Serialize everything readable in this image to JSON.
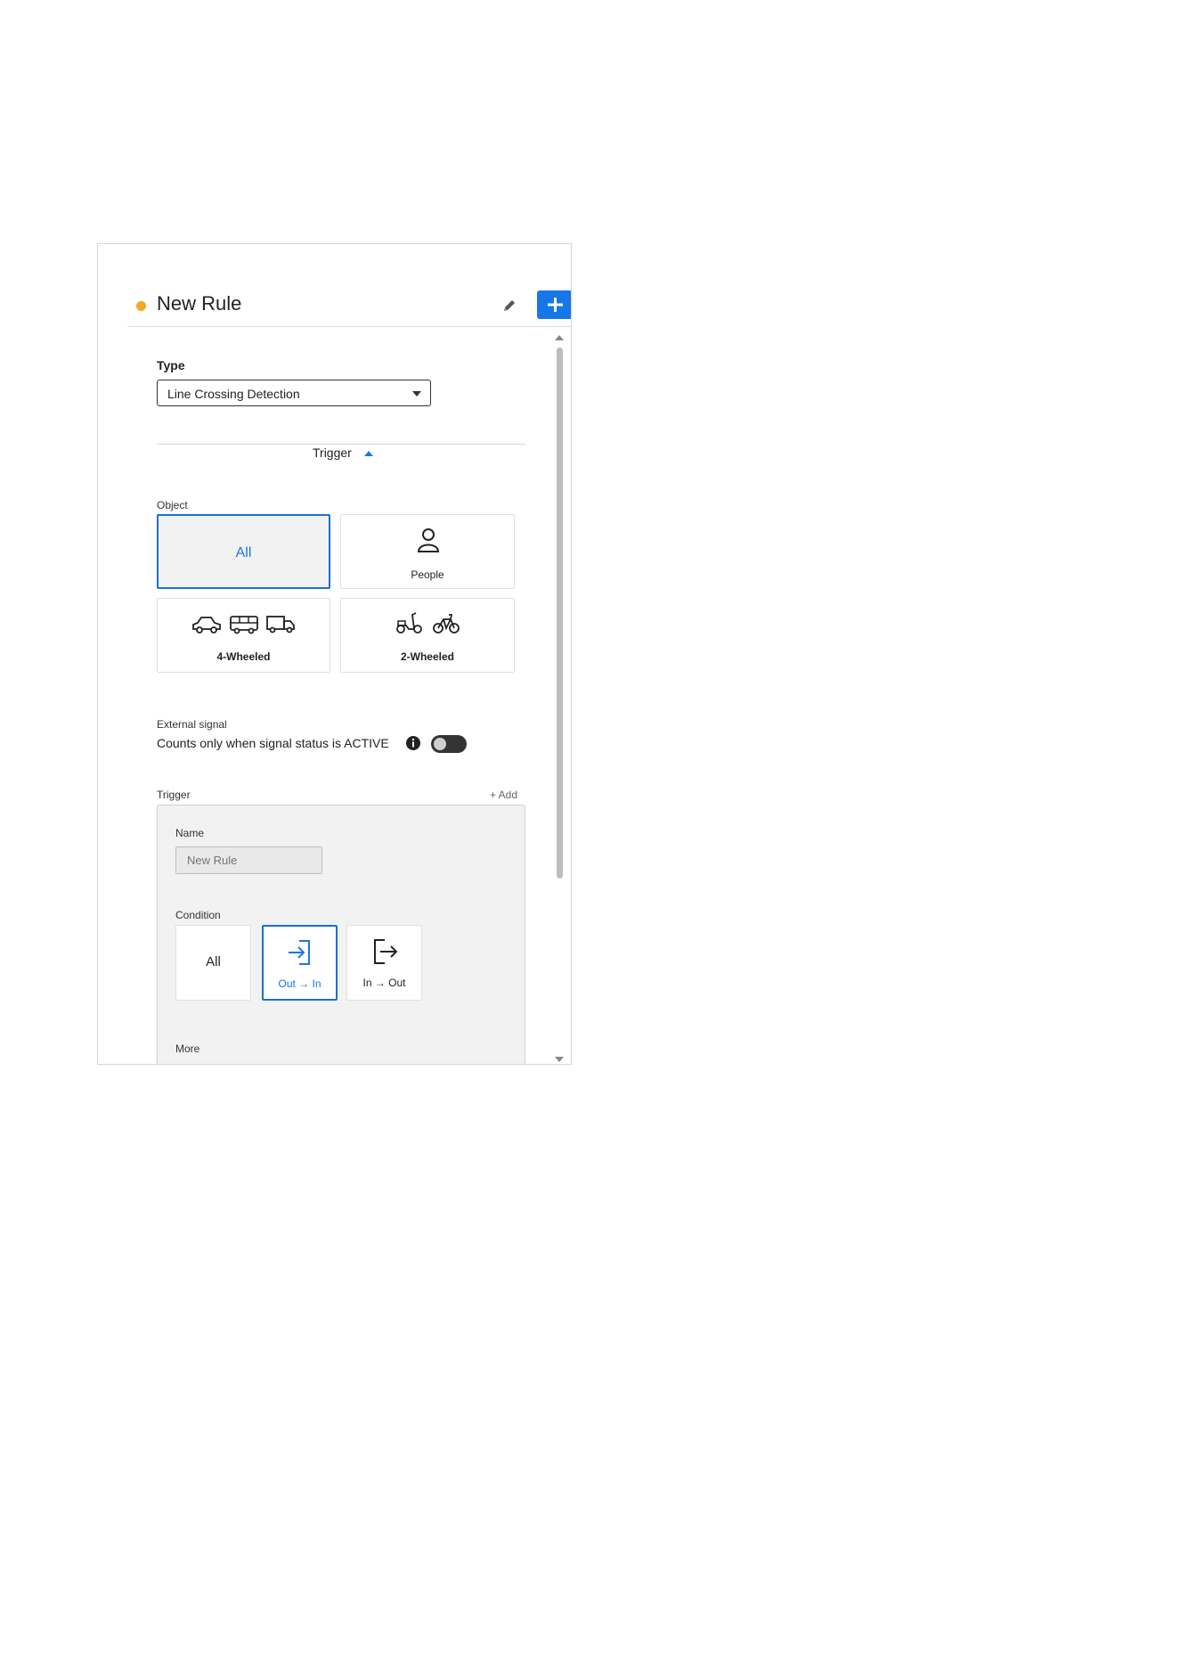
{
  "rule": {
    "title": "New Rule",
    "status_color": "#f5a623",
    "edit_icon": "pencil-icon",
    "add_icon": "plus-icon"
  },
  "type": {
    "label": "Type",
    "selected": "Line Crossing Detection"
  },
  "trigger_section": {
    "label": "Trigger",
    "expanded": true
  },
  "object": {
    "label": "Object",
    "options": [
      {
        "label": "All",
        "selected": true
      },
      {
        "label": "People",
        "icon": "person-icon",
        "selected": false
      },
      {
        "label": "4-Wheeled",
        "icons": [
          "car-icon",
          "bus-icon",
          "truck-icon"
        ],
        "selected": false
      },
      {
        "label": "2-Wheeled",
        "icons": [
          "scooter-icon",
          "bicycle-icon"
        ],
        "selected": false
      }
    ]
  },
  "external_signal": {
    "label": "External signal",
    "description": "Counts only when signal status is ACTIVE",
    "enabled": false
  },
  "trigger": {
    "label": "Trigger",
    "add_label": "+ Add",
    "name_label": "Name",
    "name_placeholder": "New Rule",
    "condition_label": "Condition",
    "conditions": [
      {
        "label": "All",
        "selected": false
      },
      {
        "label": "Out → In",
        "icon": "enter-icon",
        "selected": true
      },
      {
        "label": "In → Out",
        "icon": "exit-icon",
        "selected": false
      }
    ],
    "more_label": "More"
  },
  "colors": {
    "accent": "#1677e8",
    "selected_border": "#1a6fd4"
  }
}
